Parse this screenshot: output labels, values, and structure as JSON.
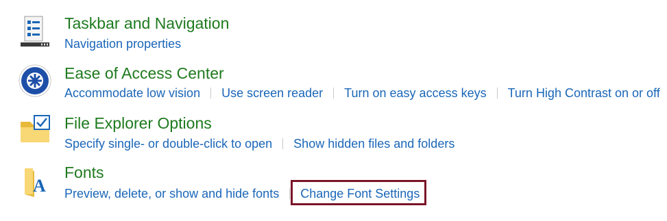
{
  "sections": [
    {
      "title": "Taskbar and Navigation",
      "icon": "taskbar-icon",
      "links": [
        "Navigation properties"
      ]
    },
    {
      "title": "Ease of Access Center",
      "icon": "ease-of-access-icon",
      "links": [
        "Accommodate low vision",
        "Use screen reader",
        "Turn on easy access keys",
        "Turn High Contrast on or off"
      ]
    },
    {
      "title": "File Explorer Options",
      "icon": "folder-checkbox-icon",
      "links": [
        "Specify single- or double-click to open",
        "Show hidden files and folders"
      ]
    },
    {
      "title": "Fonts",
      "icon": "fonts-folder-icon",
      "links": [
        "Preview, delete, or show and hide fonts",
        "Change Font Settings"
      ]
    }
  ],
  "colors": {
    "title": "#1e7a1e",
    "link": "#1a66b8",
    "highlight": "#7a1428"
  }
}
